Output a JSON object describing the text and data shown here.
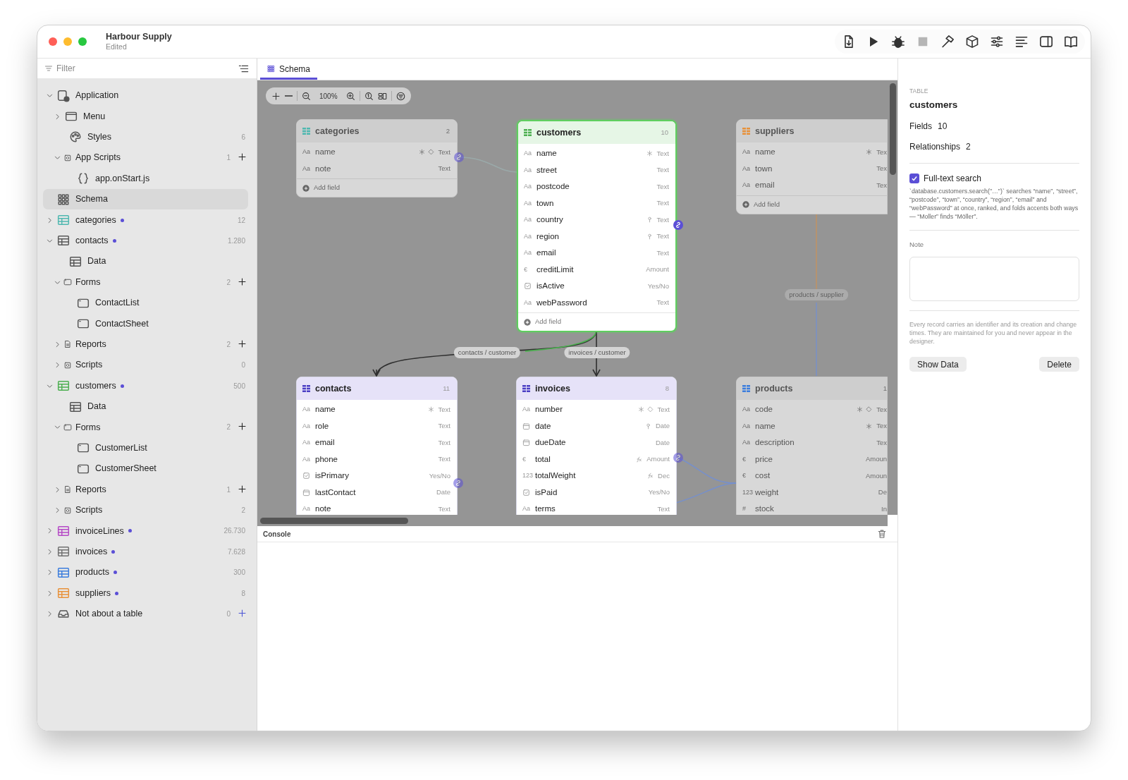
{
  "window": {
    "title": "Harbour Supply",
    "subtitle": "Edited"
  },
  "toolbar": [
    {
      "kind": "export",
      "disabled": false
    },
    {
      "kind": "run",
      "disabled": false
    },
    {
      "kind": "debug",
      "disabled": false
    },
    {
      "kind": "stop",
      "disabled": true
    },
    {
      "kind": "build",
      "disabled": false
    },
    {
      "kind": "package",
      "disabled": false
    },
    {
      "kind": "settings",
      "disabled": false
    },
    {
      "kind": "format",
      "disabled": false
    },
    {
      "kind": "sidebar",
      "disabled": false
    },
    {
      "kind": "docs",
      "disabled": false
    }
  ],
  "sidebar": {
    "filter": {
      "placeholder": "Filter"
    },
    "items": [
      {
        "label": "Application",
        "kind": "app",
        "expanded": true,
        "selected": false,
        "children": [
          {
            "label": "Menu",
            "kind": "window",
            "expanded": false,
            "selected": false
          },
          {
            "label": "Styles",
            "kind": "palette",
            "count": "6",
            "selected": false
          },
          {
            "label": "App Scripts",
            "kind": "script",
            "expanded": true,
            "count": "1",
            "add": true,
            "selected": false,
            "children": [
              {
                "label": "app.onStart.js",
                "kind": "code",
                "selected": false
              }
            ]
          }
        ]
      },
      {
        "label": "Schema",
        "kind": "schema",
        "selected": true
      },
      {
        "label": "categories",
        "kind": "table",
        "color": "#4fb8b0",
        "modified": true,
        "expanded": false,
        "count": "12",
        "selected": false
      },
      {
        "label": "contacts",
        "kind": "table",
        "color": "#5a5a5a",
        "modified": true,
        "expanded": true,
        "count": "1.280",
        "selected": false,
        "children": [
          {
            "label": "Data",
            "kind": "table",
            "selected": false
          },
          {
            "label": "Forms",
            "kind": "form",
            "expanded": true,
            "count": "2",
            "add": true,
            "selected": false,
            "children": [
              {
                "label": "ContactList",
                "kind": "form",
                "selected": false
              },
              {
                "label": "ContactSheet",
                "kind": "form",
                "selected": false
              }
            ]
          },
          {
            "label": "Reports",
            "kind": "report",
            "expanded": false,
            "count": "2",
            "add": true,
            "selected": false
          },
          {
            "label": "Scripts",
            "kind": "script",
            "expanded": false,
            "count": "0",
            "selected": false
          }
        ]
      },
      {
        "label": "customers",
        "kind": "table",
        "color": "#4caf50",
        "modified": true,
        "expanded": true,
        "count": "500",
        "selected": false,
        "children": [
          {
            "label": "Data",
            "kind": "table",
            "selected": false
          },
          {
            "label": "Forms",
            "kind": "form",
            "expanded": true,
            "count": "2",
            "add": true,
            "selected": false,
            "children": [
              {
                "label": "CustomerList",
                "kind": "form",
                "selected": false
              },
              {
                "label": "CustomerSheet",
                "kind": "form",
                "selected": false
              }
            ]
          },
          {
            "label": "Reports",
            "kind": "report",
            "expanded": false,
            "count": "1",
            "add": true,
            "selected": false
          },
          {
            "label": "Scripts",
            "kind": "script",
            "expanded": false,
            "count": "2",
            "selected": false
          }
        ]
      },
      {
        "label": "invoiceLines",
        "kind": "table",
        "color": "#b548c6",
        "modified": true,
        "expanded": false,
        "count": "26.730",
        "selected": false
      },
      {
        "label": "invoices",
        "kind": "table",
        "color": "#707070",
        "modified": true,
        "expanded": false,
        "count": "7.628",
        "selected": false
      },
      {
        "label": "products",
        "kind": "table",
        "color": "#3b7ddd",
        "modified": true,
        "expanded": false,
        "count": "300",
        "selected": false
      },
      {
        "label": "suppliers",
        "kind": "table",
        "color": "#e8913a",
        "modified": true,
        "expanded": false,
        "count": "8",
        "selected": false
      },
      {
        "label": "Not about a table",
        "kind": "tray",
        "expanded": false,
        "count": "0",
        "add": true,
        "selected": false
      }
    ]
  },
  "tabs": [
    {
      "label": "Schema",
      "selected": true
    }
  ],
  "canvas": {
    "zoom": "100%",
    "relationships": [
      {
        "label": "contacts / customer",
        "dimmed": false
      },
      {
        "label": "invoices / customer",
        "dimmed": false
      },
      {
        "label": "products / supplier",
        "dimmed": true
      }
    ],
    "tables": [
      {
        "name": "categories",
        "count": "2",
        "color": "#4fb8b0",
        "selected": false,
        "dimmed": true,
        "add_label": "Add field",
        "fields": [
          {
            "kind": "glyph",
            "glyph": "Aa",
            "name": "name",
            "required": true,
            "unique": true,
            "type": "Text"
          },
          {
            "kind": "glyph",
            "glyph": "Aa",
            "name": "note",
            "type": "Text"
          }
        ]
      },
      {
        "name": "customers",
        "count": "10",
        "color": "#4caf50",
        "selected": true,
        "dimmed": false,
        "add_label": "Add field",
        "fields": [
          {
            "kind": "glyph",
            "glyph": "Aa",
            "name": "name",
            "required": true,
            "type": "Text"
          },
          {
            "kind": "glyph",
            "glyph": "Aa",
            "name": "street",
            "type": "Text"
          },
          {
            "kind": "glyph",
            "glyph": "Aa",
            "name": "postcode",
            "type": "Text"
          },
          {
            "kind": "glyph",
            "glyph": "Aa",
            "name": "town",
            "type": "Text"
          },
          {
            "kind": "glyph",
            "glyph": "Aa",
            "name": "country",
            "indexed": true,
            "type": "Text"
          },
          {
            "kind": "glyph",
            "glyph": "Aa",
            "name": "region",
            "indexed": true,
            "type": "Text"
          },
          {
            "kind": "glyph",
            "glyph": "Aa",
            "name": "email",
            "type": "Text"
          },
          {
            "kind": "glyph",
            "glyph": "€",
            "name": "creditLimit",
            "type": "Amount"
          },
          {
            "kind": "checkbox",
            "name": "isActive",
            "type": "Yes/No"
          },
          {
            "kind": "glyph",
            "glyph": "Aa",
            "name": "webPassword",
            "type": "Text"
          }
        ]
      },
      {
        "name": "suppliers",
        "color": "#e8913a",
        "selected": false,
        "dimmed": true,
        "add_label": "Add field",
        "fields": [
          {
            "kind": "glyph",
            "glyph": "Aa",
            "name": "name",
            "required": true,
            "type": "Tex"
          },
          {
            "kind": "glyph",
            "glyph": "Aa",
            "name": "town",
            "type": "Tex"
          },
          {
            "kind": "glyph",
            "glyph": "Aa",
            "name": "email",
            "type": "Tex"
          }
        ]
      },
      {
        "name": "contacts",
        "count": "11",
        "color": "#4b3fc4",
        "selected": false,
        "dimmed": false,
        "fields": [
          {
            "kind": "glyph",
            "glyph": "Aa",
            "name": "name",
            "required": true,
            "type": "Text"
          },
          {
            "kind": "glyph",
            "glyph": "Aa",
            "name": "role",
            "type": "Text"
          },
          {
            "kind": "glyph",
            "glyph": "Aa",
            "name": "email",
            "type": "Text"
          },
          {
            "kind": "glyph",
            "glyph": "Aa",
            "name": "phone",
            "type": "Text"
          },
          {
            "kind": "checkbox",
            "name": "isPrimary",
            "type": "Yes/No"
          },
          {
            "kind": "date",
            "name": "lastContact",
            "type": "Date"
          },
          {
            "kind": "glyph",
            "glyph": "Aa",
            "name": "note",
            "type": "Text"
          }
        ]
      },
      {
        "name": "invoices",
        "count": "8",
        "color": "#4b3fc4",
        "selected": false,
        "dimmed": false,
        "fields": [
          {
            "kind": "glyph",
            "glyph": "Aa",
            "name": "number",
            "required": true,
            "unique": true,
            "type": "Text"
          },
          {
            "kind": "date",
            "name": "date",
            "indexed": true,
            "type": "Date"
          },
          {
            "kind": "date",
            "name": "dueDate",
            "type": "Date"
          },
          {
            "kind": "glyph",
            "glyph": "€",
            "name": "total",
            "calculated": true,
            "type": "Amount"
          },
          {
            "kind": "glyph",
            "glyph": "123",
            "name": "totalWeight",
            "calculated": true,
            "type": "Dec"
          },
          {
            "kind": "checkbox",
            "name": "isPaid",
            "type": "Yes/No"
          },
          {
            "kind": "glyph",
            "glyph": "Aa",
            "name": "terms",
            "type": "Text"
          }
        ]
      },
      {
        "name": "products",
        "count": "1",
        "color": "#3b7ddd",
        "selected": false,
        "dimmed": true,
        "fields": [
          {
            "kind": "glyph",
            "glyph": "Aa",
            "name": "code",
            "required": true,
            "unique": true,
            "type": "Tex"
          },
          {
            "kind": "glyph",
            "glyph": "Aa",
            "name": "name",
            "required": true,
            "type": "Tex"
          },
          {
            "kind": "glyph",
            "glyph": "Aa",
            "name": "description",
            "type": "Tex"
          },
          {
            "kind": "glyph",
            "glyph": "€",
            "name": "price",
            "type": "Amoun"
          },
          {
            "kind": "glyph",
            "glyph": "€",
            "name": "cost",
            "type": "Amoun"
          },
          {
            "kind": "glyph",
            "glyph": "123",
            "name": "weight",
            "type": "De"
          },
          {
            "kind": "glyph",
            "glyph": "#",
            "name": "stock",
            "type": "In"
          }
        ]
      }
    ]
  },
  "console": {
    "title": "Console"
  },
  "inspector": {
    "kicker": "TABLE",
    "title": "customers",
    "stats": [
      {
        "label": "Fields",
        "value": "10"
      },
      {
        "label": "Relationships",
        "value": "2"
      }
    ],
    "fulltext": {
      "label": "Full-text search",
      "checked": true,
      "description": "`database.customers.search(\"…\")` searches “name”, “street”, “postcode”, “town”, “country”, “region”, “email” and “webPassword” at once, ranked, and folds accents both ways — “Moller” finds “Möller”."
    },
    "note_label": "Note",
    "footnote": "Every record carries an identifier and its creation and change times. They are maintained for you and never appear in the designer.",
    "buttons": [
      "Show Data",
      "Delete"
    ]
  }
}
